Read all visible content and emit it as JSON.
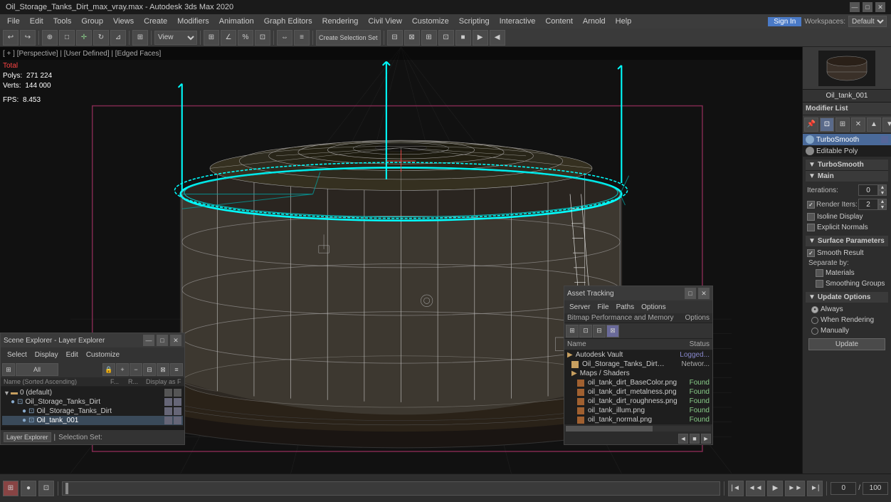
{
  "titlebar": {
    "title": "Oil_Storage_Tanks_Dirt_max_vray.max - Autodesk 3ds Max 2020",
    "min": "—",
    "max": "□",
    "close": "✕"
  },
  "menubar": {
    "items": [
      "File",
      "Edit",
      "Tools",
      "Group",
      "Views",
      "Create",
      "Modifiers",
      "Animation",
      "Graph Editors",
      "Rendering",
      "Civil View",
      "Customize",
      "Scripting",
      "Interactive",
      "Content",
      "Arnold",
      "Help"
    ]
  },
  "signin": {
    "label": "Sign In",
    "workspaces": "Workspaces:",
    "workspace_value": "Default"
  },
  "viewport": {
    "header": "[ + ] [Perspective] | [User Defined] | [Edged Faces]",
    "stats_label": "Total",
    "polys_label": "Polys:",
    "polys_value": "271 224",
    "verts_label": "Verts:",
    "verts_value": "144 000",
    "fps_label": "FPS:",
    "fps_value": "8.453"
  },
  "right_panel": {
    "object_name": "Oil_tank_001",
    "modifier_list_label": "Modifier List",
    "modifiers": [
      {
        "name": "TurboSmooth",
        "selected": true
      },
      {
        "name": "Editable Poly",
        "selected": false
      }
    ],
    "turbosmooth": {
      "section_main": "Main",
      "iterations_label": "Iterations:",
      "iterations_value": "0",
      "render_iters_label": "Render Iters:",
      "render_iters_value": "2",
      "isoline_display": "Isoline Display",
      "explicit_normals": "Explicit Normals",
      "surface_params": "Surface Parameters",
      "smooth_result": "Smooth Result",
      "separate_by": "Separate by:",
      "materials": "Materials",
      "smoothing_groups": "Smoothing Groups",
      "update_options": "Update Options",
      "always": "Always",
      "when_rendering": "When Rendering",
      "manually": "Manually",
      "update_label": "Update"
    }
  },
  "scene_explorer": {
    "title": "Scene Explorer - Layer Explorer",
    "menus": [
      "Select",
      "Display",
      "Edit",
      "Customize"
    ],
    "column_headers": [
      "Name (Sorted Ascending)",
      "F...",
      "R...",
      "Display as F"
    ],
    "items": [
      {
        "indent": 0,
        "name": "0 (default)",
        "arrow": "▼",
        "type": "layer"
      },
      {
        "indent": 1,
        "name": "Oil_Storage_Tanks_Dirt",
        "arrow": "",
        "type": "object"
      },
      {
        "indent": 2,
        "name": "Oil_Storage_Tanks_Dirt",
        "arrow": "",
        "type": "object"
      },
      {
        "indent": 2,
        "name": "Oil_tank_001",
        "arrow": "",
        "type": "object",
        "selected": true
      }
    ],
    "footer": {
      "explorer_label": "Layer Explorer",
      "selection_label": "Selection Set:"
    }
  },
  "asset_tracking": {
    "title": "Asset Tracking",
    "menus": [
      "Server",
      "File",
      "Paths",
      "Options"
    ],
    "buttons": [
      "grid1",
      "grid2",
      "grid3",
      "grid4",
      "active"
    ],
    "columns": [
      "Name",
      "Status"
    ],
    "items": [
      {
        "indent": 0,
        "name": "Autodesk Vault",
        "status": "Logged..."
      },
      {
        "indent": 1,
        "name": "Oil_Storage_Tanks_Dirt_max_vray.max",
        "status": "Networ..."
      },
      {
        "indent": 1,
        "name": "Maps / Shaders",
        "status": ""
      },
      {
        "indent": 2,
        "name": "oil_tank_dirt_BaseColor.png",
        "status": "Found"
      },
      {
        "indent": 2,
        "name": "oil_tank_dirt_metalness.png",
        "status": "Found"
      },
      {
        "indent": 2,
        "name": "oil_tank_dirt_roughness.png",
        "status": "Found"
      },
      {
        "indent": 2,
        "name": "oil_tank_illum.png",
        "status": "Found"
      },
      {
        "indent": 2,
        "name": "oil_tank_normal.png",
        "status": "Found"
      }
    ]
  }
}
